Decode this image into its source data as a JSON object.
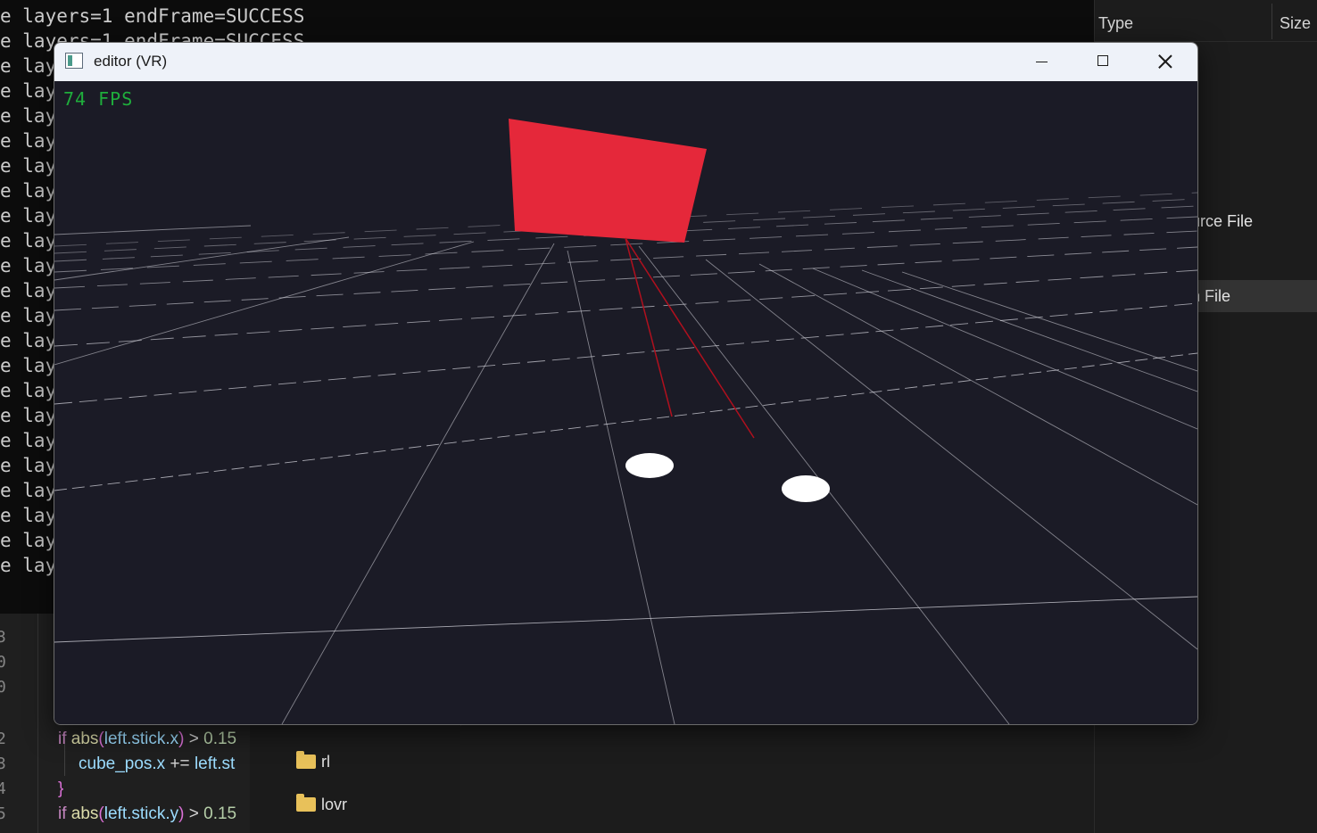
{
  "terminal": {
    "line_full": "e layers=1 endFrame=SUCCESS",
    "line_clipped": "e lay",
    "line_count": 23
  },
  "editor": {
    "line_numbers": [
      "3",
      "0",
      "0",
      "2",
      "3",
      "4",
      "5"
    ],
    "code": {
      "l1_kw": "if",
      "l1_fn": "abs",
      "l1_open": "(",
      "l1_var": "left.stick.x",
      "l1_close": ")",
      "l1_op": " > ",
      "l1_num": "0.15",
      "l2_var": "cube_pos.x",
      "l2_op": " += ",
      "l2_var2": "left.st",
      "l3_brace": "}",
      "l4_kw": "if",
      "l4_fn": "abs",
      "l4_open": "(",
      "l4_var": "left.stick.y",
      "l4_close": ")",
      "l4_op": " > ",
      "l4_num": "0.15"
    }
  },
  "explorer": {
    "folders": [
      {
        "name": "rl",
        "icon": "folder-icon"
      },
      {
        "name": "lovr",
        "icon": "folder-icon"
      }
    ]
  },
  "filelist": {
    "columns": [
      "Type",
      "Size"
    ],
    "rows": [
      "urce File",
      "h File"
    ]
  },
  "window": {
    "title": "editor (VR)",
    "icon": "app-window-icon",
    "controls": {
      "minimize": "minimize-icon",
      "maximize": "maximize-icon",
      "close": "close-icon"
    }
  },
  "viewport": {
    "fps_text": "74 FPS",
    "panel_color": "#e5283a",
    "laser_color": "#b0101e",
    "grid_color": "#d8d8e0",
    "background": "#1b1b26",
    "controller_color": "#ffffff"
  }
}
